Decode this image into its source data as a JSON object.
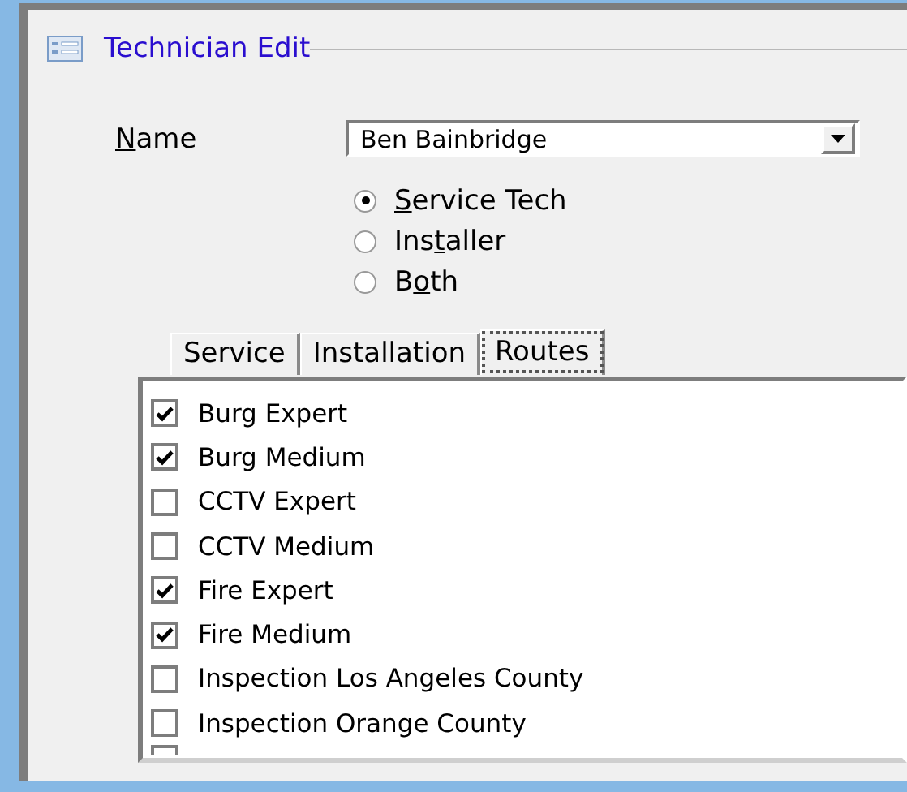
{
  "group": {
    "title": "Technician Edit"
  },
  "name_field": {
    "label": {
      "key": "N",
      "after": "ame"
    },
    "value": "Ben Bainbridge"
  },
  "roles": [
    {
      "label": {
        "key": "S",
        "after": "ervice Tech"
      },
      "selected": true
    },
    {
      "label": {
        "before": "Ins",
        "key": "t",
        "after": "aller"
      },
      "selected": false
    },
    {
      "label": {
        "before": "B",
        "key": "o",
        "after": "th"
      },
      "selected": false
    }
  ],
  "tabs": [
    {
      "label": "Service",
      "selected": false
    },
    {
      "label": "Installation",
      "selected": false
    },
    {
      "label": "Routes",
      "selected": true
    }
  ],
  "routes": [
    {
      "label": "Burg Expert",
      "checked": true
    },
    {
      "label": "Burg Medium",
      "checked": true
    },
    {
      "label": "CCTV Expert",
      "checked": false
    },
    {
      "label": "CCTV Medium",
      "checked": false
    },
    {
      "label": "Fire Expert",
      "checked": true
    },
    {
      "label": "Fire Medium",
      "checked": true
    },
    {
      "label": "Inspection Los Angeles County",
      "checked": false
    },
    {
      "label": "Inspection Orange County",
      "checked": false
    }
  ]
}
